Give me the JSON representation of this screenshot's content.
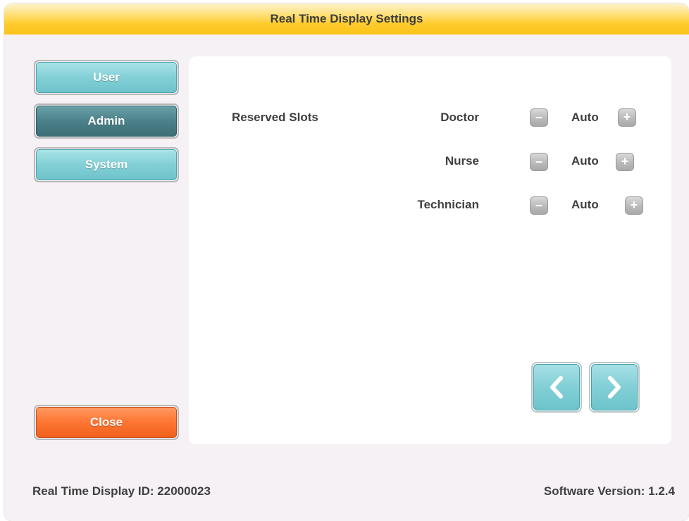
{
  "window": {
    "title": "Real Time Display Settings"
  },
  "sidebar": {
    "items": [
      {
        "label": "User",
        "active": false
      },
      {
        "label": "Admin",
        "active": true
      },
      {
        "label": "System",
        "active": false
      }
    ],
    "close_label": "Close"
  },
  "settings": {
    "section_label": "Reserved Slots",
    "rows": [
      {
        "role": "Doctor",
        "value": "Auto"
      },
      {
        "role": "Nurse",
        "value": "Auto"
      },
      {
        "role": "Technician",
        "value": "Auto"
      }
    ],
    "minus_glyph": "–",
    "plus_glyph": "+"
  },
  "footer": {
    "display_id": "Real Time Display ID: 22000023",
    "software_version": "Software Version: 1.2.4"
  },
  "colors": {
    "title_bar": "#ffcc2e",
    "nav_teal": "#82d0d6",
    "nav_active": "#4b8189",
    "close_orange": "#ff7836",
    "background": "#f5f1f5"
  },
  "icons": {
    "prev": "chevron-left-icon",
    "next": "chevron-right-icon"
  }
}
